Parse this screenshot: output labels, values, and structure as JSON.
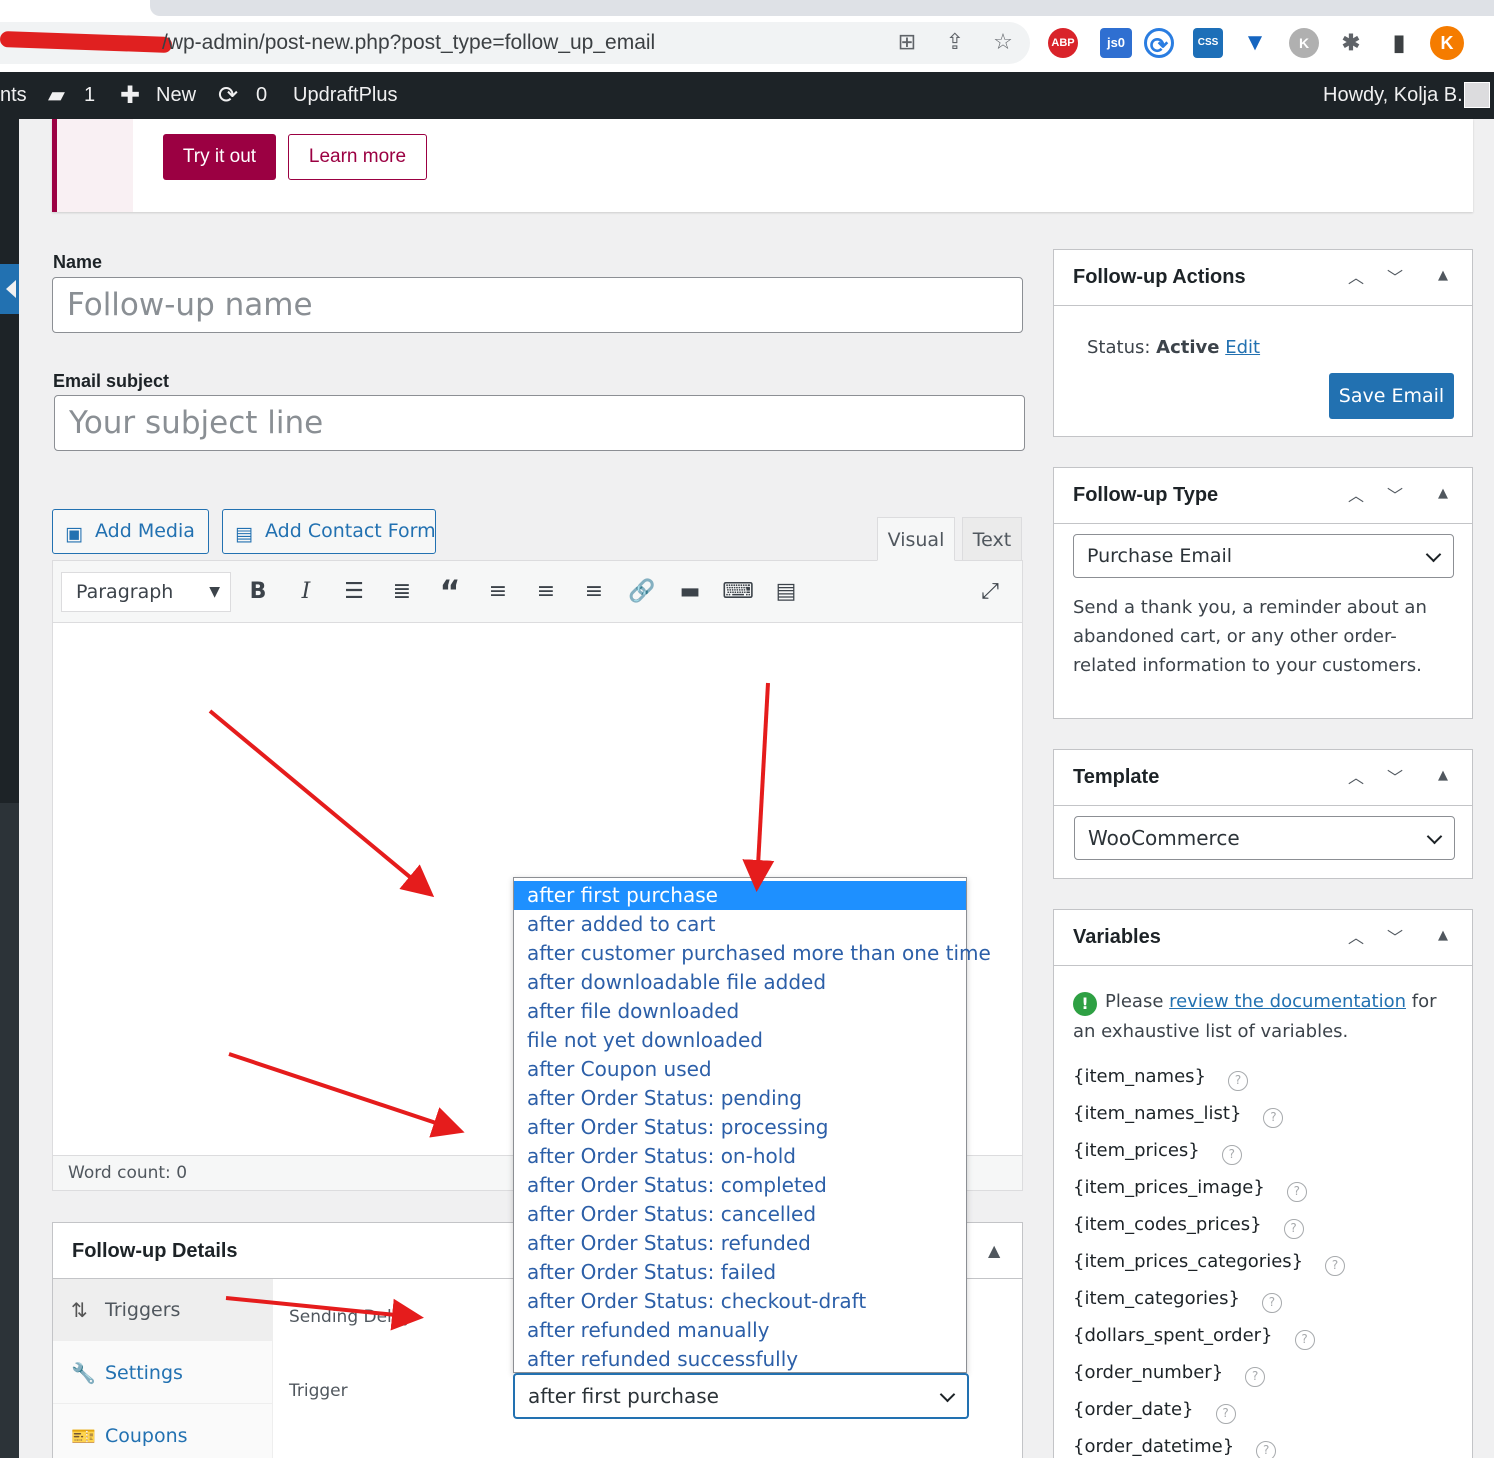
{
  "browser": {
    "url": "/wp-admin/post-new.php?post_type=follow_up_email",
    "profile_initial": "K",
    "extensions": [
      "ABP",
      "js0"
    ]
  },
  "adminbar": {
    "partial_left": "nts",
    "comments_count": "1",
    "new_label": "New",
    "updates_count": "0",
    "plugin_label": "UpdraftPlus",
    "howdy": "Howdy, Kolja B."
  },
  "notice": {
    "try_label": "Try it out",
    "learn_label": "Learn more"
  },
  "form": {
    "name_label": "Name",
    "name_placeholder": "Follow-up name",
    "subject_label": "Email subject",
    "subject_placeholder": "Your subject line"
  },
  "editor": {
    "add_media": "Add Media",
    "add_contact_form": "Add Contact Form",
    "tab_visual": "Visual",
    "tab_text": "Text",
    "format": "Paragraph",
    "word_count": "Word count: 0"
  },
  "details": {
    "title": "Follow-up Details",
    "nav": [
      "Triggers",
      "Settings",
      "Coupons"
    ],
    "sending_delay_label": "Sending Delay",
    "trigger_label": "Trigger",
    "trigger_value": "after first purchase",
    "trigger_options": [
      "after first purchase",
      "after added to cart",
      "after customer purchased more than one time",
      "after downloadable file added",
      "after file downloaded",
      "file not yet downloaded",
      "after Coupon used",
      "after Order Status: pending",
      "after Order Status: processing",
      "after Order Status: on-hold",
      "after Order Status: completed",
      "after Order Status: cancelled",
      "after Order Status: refunded",
      "after Order Status: failed",
      "after Order Status: checkout-draft",
      "after refunded manually",
      "after refunded successfully"
    ]
  },
  "sidebar": {
    "actions": {
      "title": "Follow-up Actions",
      "status_label": "Status:",
      "status_value": "Active",
      "edit_label": "Edit",
      "save_label": "Save Email"
    },
    "type": {
      "title": "Follow-up Type",
      "value": "Purchase Email",
      "description": "Send a thank you, a reminder about an abandoned cart, or any other order-related information to your customers."
    },
    "template": {
      "title": "Template",
      "value": "WooCommerce"
    },
    "variables": {
      "title": "Variables",
      "notice_prefix": "Please",
      "notice_link": "review the documentation",
      "notice_suffix": "for an exhaustive list of variables.",
      "items": [
        "{item_names}",
        "{item_names_list}",
        "{item_prices}",
        "{item_prices_image}",
        "{item_codes_prices}",
        "{item_prices_categories}",
        "{item_categories}",
        "{dollars_spent_order}",
        "{order_number}",
        "{order_date}",
        "{order_datetime}"
      ]
    }
  },
  "colors": {
    "wp_blue": "#2271b1",
    "brand_plum": "#9b0042",
    "annotation_red": "#e51c1c",
    "dropdown_highlight": "#1e90ff"
  }
}
